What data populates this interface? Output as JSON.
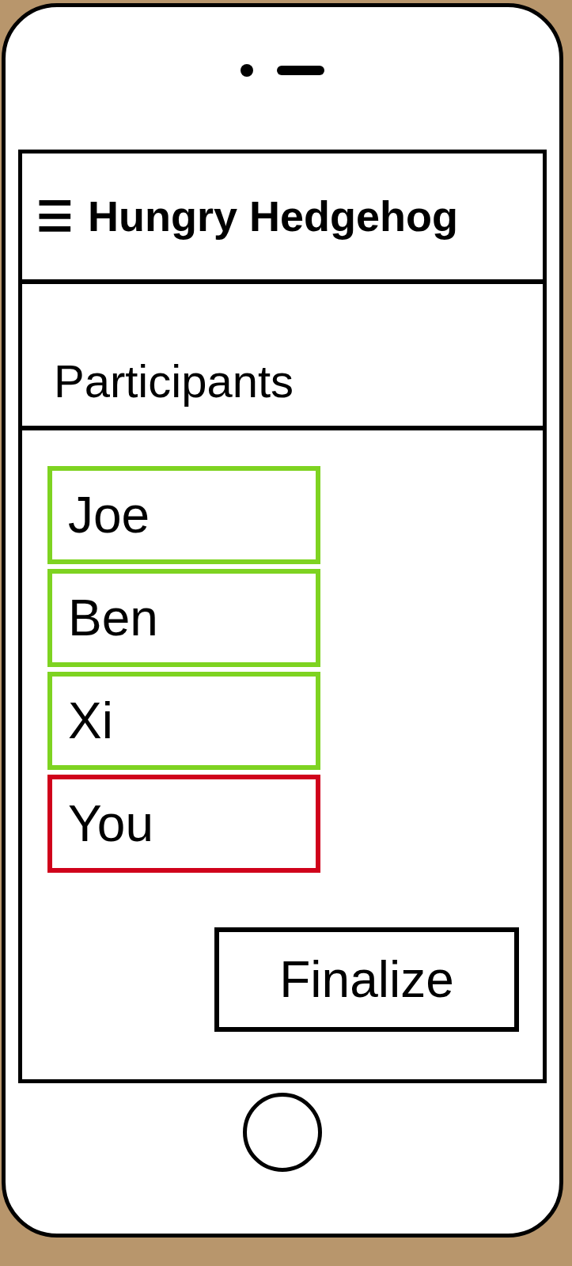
{
  "app": {
    "menu_icon": "☰",
    "title": "Hungry Hedgehog"
  },
  "section": {
    "title": "Participants"
  },
  "participants": [
    {
      "name": "Joe",
      "color": "#7ed321"
    },
    {
      "name": "Ben",
      "color": "#7ed321"
    },
    {
      "name": "Xi",
      "color": "#7ed321"
    },
    {
      "name": "You",
      "color": "#d0021b"
    }
  ],
  "buttons": [
    "Finalize"
  ]
}
